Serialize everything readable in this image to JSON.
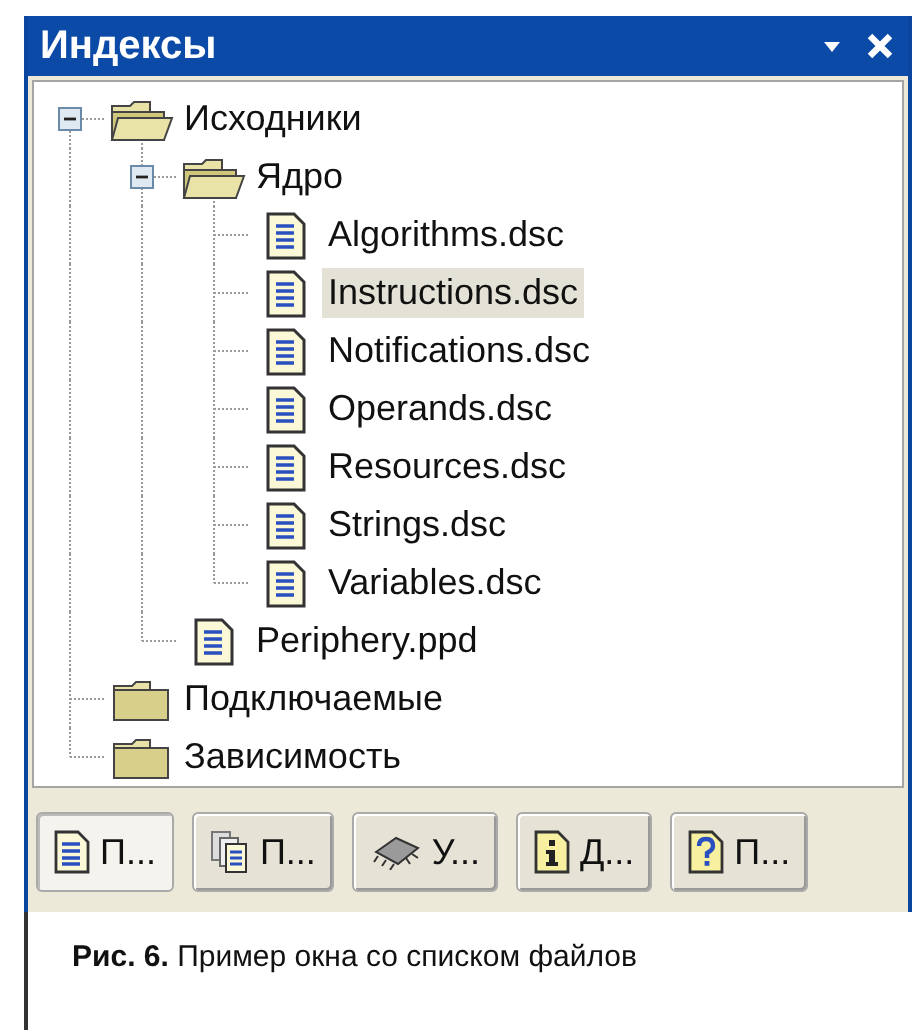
{
  "window": {
    "title": "Индексы"
  },
  "tree": [
    {
      "label": "Исходники",
      "kind": "folder",
      "expanded": true,
      "selected": false,
      "children": [
        {
          "label": "Ядро",
          "kind": "folder",
          "expanded": true,
          "selected": false,
          "children": [
            {
              "label": "Algorithms.dsc",
              "kind": "file",
              "selected": false
            },
            {
              "label": "Instructions.dsc",
              "kind": "file",
              "selected": true
            },
            {
              "label": "Notifications.dsc",
              "kind": "file",
              "selected": false
            },
            {
              "label": "Operands.dsc",
              "kind": "file",
              "selected": false
            },
            {
              "label": "Resources.dsc",
              "kind": "file",
              "selected": false
            },
            {
              "label": "Strings.dsc",
              "kind": "file",
              "selected": false
            },
            {
              "label": "Variables.dsc",
              "kind": "file",
              "selected": false
            }
          ]
        },
        {
          "label": "Periphery.ppd",
          "kind": "file",
          "selected": false
        }
      ]
    },
    {
      "label": "Подключаемые",
      "kind": "folder",
      "selected": false
    },
    {
      "label": "Зависимость",
      "kind": "folder",
      "selected": false
    }
  ],
  "tabs": [
    {
      "label": "П...",
      "selected": true
    },
    {
      "label": "П...",
      "selected": false
    },
    {
      "label": "У...",
      "selected": false
    },
    {
      "label": "Д...",
      "selected": false
    },
    {
      "label": "П...",
      "selected": false
    }
  ],
  "caption": "**Рис. 6.** Пример окна со списком файлов"
}
